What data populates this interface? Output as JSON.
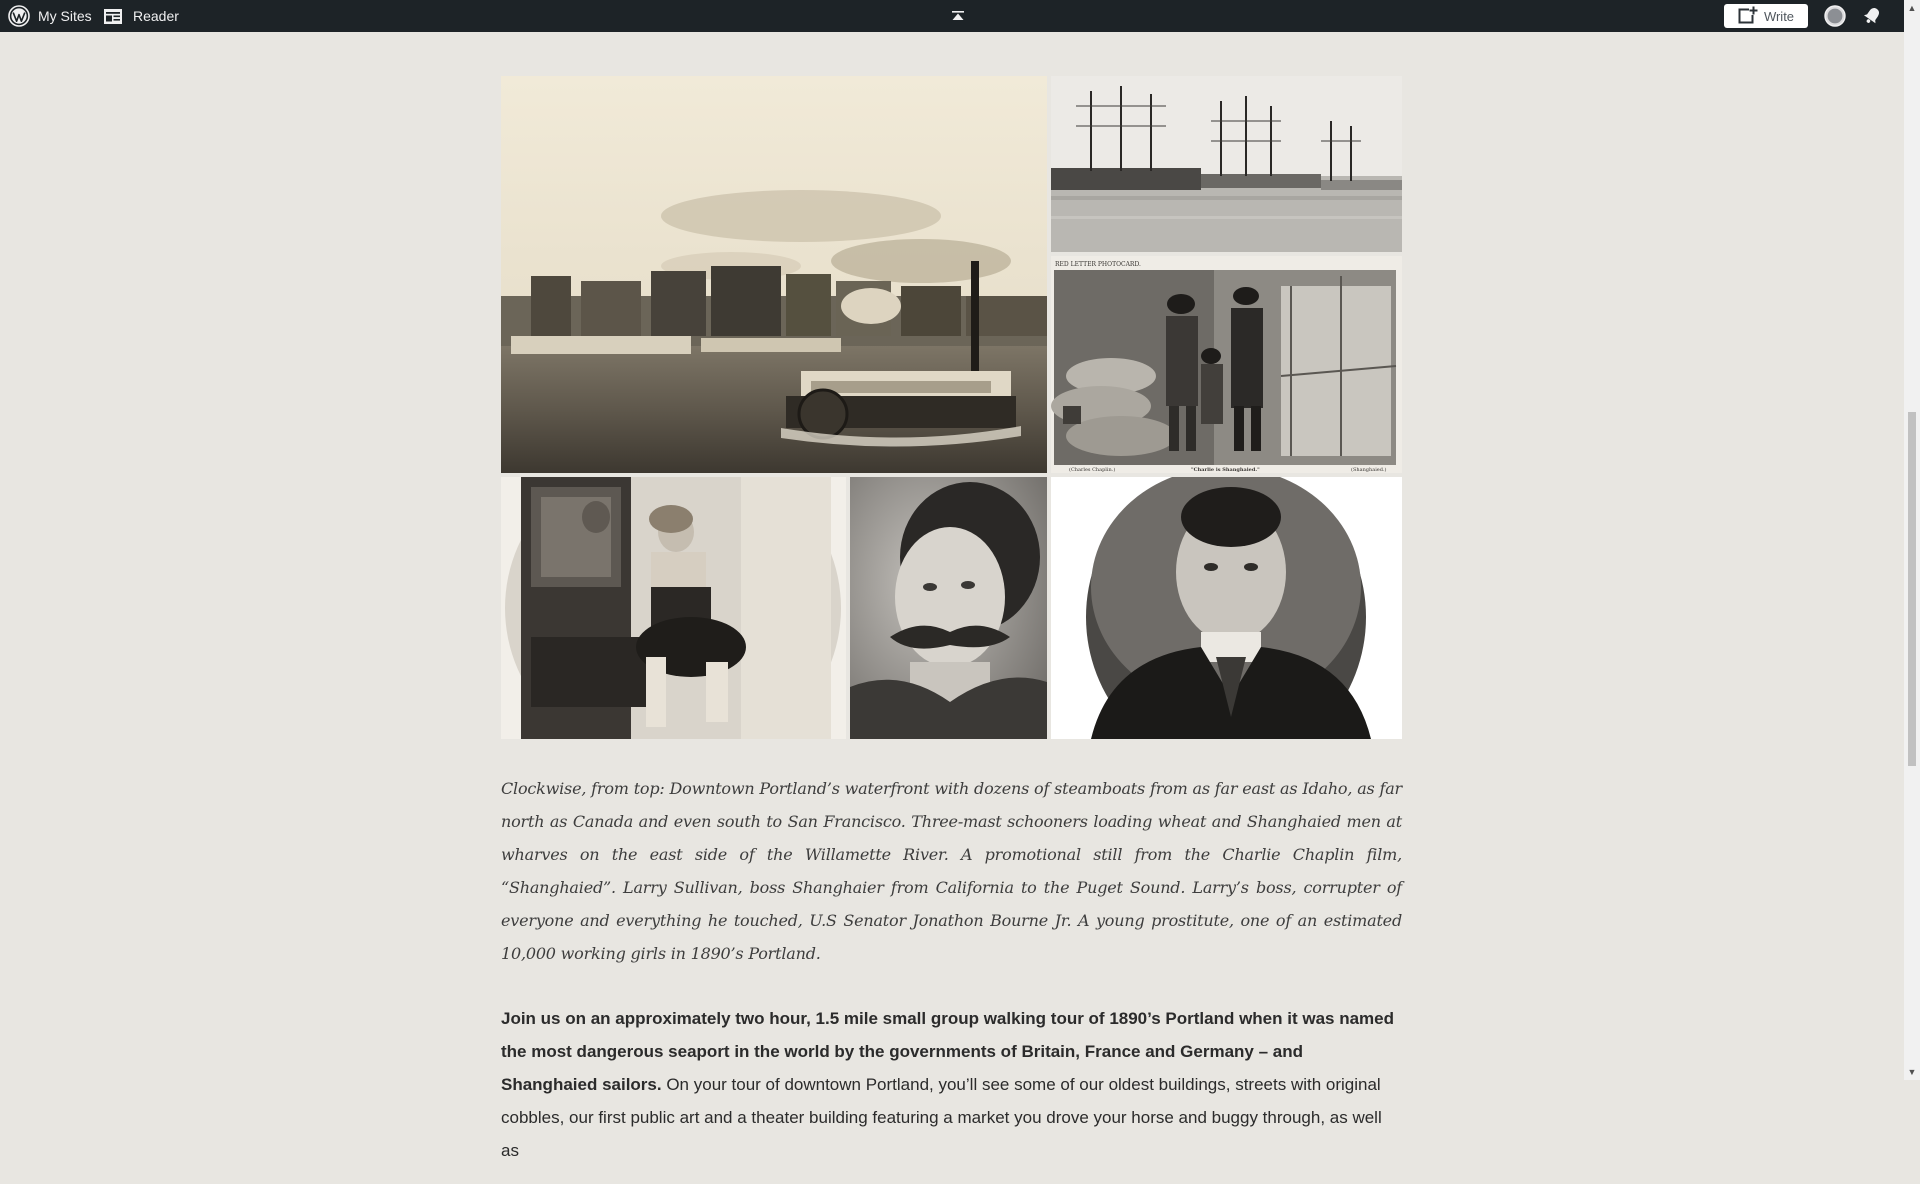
{
  "adminbar": {
    "my_sites_label": "My Sites",
    "reader_label": "Reader",
    "write_label": "Write"
  },
  "gallery": {
    "images": [
      {
        "name": "steamboat-photo",
        "alt": "Downtown Portland waterfront with steamboats"
      },
      {
        "name": "schooners-photo",
        "alt": "Three-mast schooners at wharves"
      },
      {
        "name": "chaplin-still-photo",
        "alt": "Still from the Charlie Chaplin film Shanghaied"
      },
      {
        "name": "young-woman-photo",
        "alt": "Young prostitute"
      },
      {
        "name": "sullivan-portrait",
        "alt": "Larry Sullivan"
      },
      {
        "name": "bourne-portrait",
        "alt": "U.S Senator Jonathon Bourne Jr."
      }
    ],
    "chaplin_card": {
      "header": "RED LETTER PHOTOCARD.",
      "left_caption": "(Charles Chaplin.)",
      "center_caption": "\"Charlie is Shanghaied.\"",
      "right_caption": "(Shanghaied.)"
    }
  },
  "caption": "Clockwise, from top: Downtown Portland’s waterfront with dozens of steamboats from as far east as Idaho, as far north as Canada and even south to San Francisco. Three-mast schooners loading wheat and Shanghaied men at wharves on the east side of the Willamette River. A promotional still from the Charlie Chaplin film, “Shanghaied”. Larry Sullivan, boss Shanghaier from California to the Puget Sound. Larry’s boss, corrupter of everyone and everything he touched, U.S Senator Jonathon Bourne Jr. A young prostitute, one of an estimated 10,000 working girls in 1890’s Portland.",
  "body": {
    "bold": "Join us on an approximately two hour, 1.5  mile small group walking tour of 1890’s Portland when it was named the most dangerous seaport in the world by the governments of Britain, France and Germany – and Shanghaied sailors.",
    "rest": " On your tour of downtown Portland, you’ll see some of our oldest buildings, streets with original cobbles, our first public art and a theater building featuring a market you drove your horse and buggy through, as well as"
  },
  "colors": {
    "adminbar_bg": "#1d2327",
    "page_bg": "#e8e6e1",
    "write_button_bg": "#ffffff"
  }
}
